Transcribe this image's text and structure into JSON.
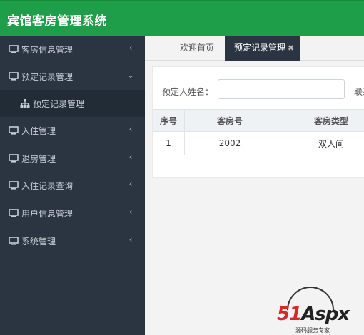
{
  "header": {
    "title": "宾馆客房管理系统"
  },
  "sidebar": {
    "items": [
      {
        "label": "客房信息管理",
        "chevron": "‹"
      },
      {
        "label": "预定记录管理",
        "chevron": "⌄"
      },
      {
        "label": "预定记录管理"
      },
      {
        "label": "入住管理",
        "chevron": "‹"
      },
      {
        "label": "退房管理",
        "chevron": "‹"
      },
      {
        "label": "入住记录查询",
        "chevron": "‹"
      },
      {
        "label": "用户信息管理",
        "chevron": "‹"
      },
      {
        "label": "系统管理",
        "chevron": "‹"
      }
    ]
  },
  "tabs": {
    "home": "欢迎首页",
    "active": "预定记录管理",
    "close": "✖"
  },
  "search": {
    "label": "预定人姓名：",
    "value": "",
    "contact_label": "联系"
  },
  "table": {
    "headers": [
      "序号",
      "客房号",
      "客房类型"
    ],
    "rows": [
      [
        "1",
        "2002",
        "双人间"
      ]
    ]
  },
  "watermark": {
    "brand": "51",
    "brand_rest": "Aspx",
    "tagline": "源码服务专家"
  },
  "colors": {
    "header": "#1f9e4a",
    "sidebar": "#2a3541",
    "active_tab": "#2a3541"
  }
}
